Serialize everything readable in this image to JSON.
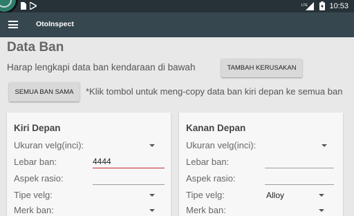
{
  "status_bar": {
    "time": "10:53",
    "signal": "LTE"
  },
  "app_bar": {
    "title": "OtoInspect"
  },
  "page": {
    "title": "Data Ban",
    "instruction": "Harap lengkapi data ban kendaraan di bawah",
    "add_damage_button": "TAMBAH KERUSAKAN",
    "all_same_button": "SEMUA BAN SAMA",
    "copy_note": "*Klik tombol untuk meng-copy data ban kiri depan ke semua ban"
  },
  "cards": {
    "front_left": {
      "title": "Kiri Depan",
      "rim_size_label": "Ukuran velg(inci):",
      "width_label": "Lebar ban:",
      "width_value": "4444",
      "aspect_label": "Aspek rasio:",
      "aspect_value": "",
      "rim_type_label": "Tipe velg:",
      "rim_type_value": "",
      "tire_brand_label": "Merk ban:"
    },
    "front_right": {
      "title": "Kanan Depan",
      "rim_size_label": "Ukuran velg(inci):",
      "width_label": "Lebar ban:",
      "width_value": "",
      "aspect_label": "Aspek rasio:",
      "aspect_value": "",
      "rim_type_label": "Tipe velg:",
      "rim_type_value": "Alloy",
      "tire_brand_label": "Merk ban:"
    }
  },
  "colors": {
    "status_bar": "#263238",
    "app_bar": "#37474f",
    "focus_underline": "#c62828",
    "background": "#e8e8e8"
  }
}
